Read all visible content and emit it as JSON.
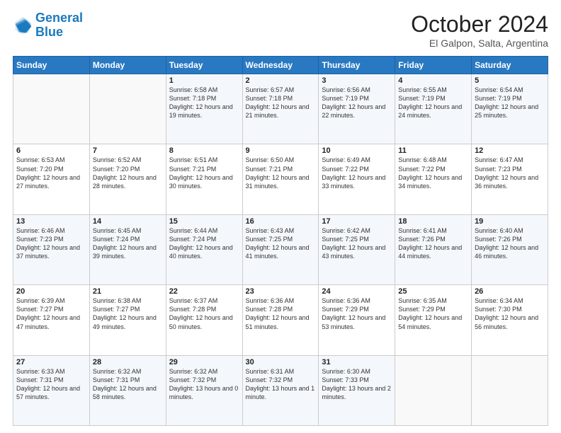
{
  "logo": {
    "line1": "General",
    "line2": "Blue"
  },
  "title": "October 2024",
  "subtitle": "El Galpon, Salta, Argentina",
  "weekdays": [
    "Sunday",
    "Monday",
    "Tuesday",
    "Wednesday",
    "Thursday",
    "Friday",
    "Saturday"
  ],
  "weeks": [
    [
      {
        "day": "",
        "info": ""
      },
      {
        "day": "",
        "info": ""
      },
      {
        "day": "1",
        "info": "Sunrise: 6:58 AM\nSunset: 7:18 PM\nDaylight: 12 hours and 19 minutes."
      },
      {
        "day": "2",
        "info": "Sunrise: 6:57 AM\nSunset: 7:18 PM\nDaylight: 12 hours and 21 minutes."
      },
      {
        "day": "3",
        "info": "Sunrise: 6:56 AM\nSunset: 7:19 PM\nDaylight: 12 hours and 22 minutes."
      },
      {
        "day": "4",
        "info": "Sunrise: 6:55 AM\nSunset: 7:19 PM\nDaylight: 12 hours and 24 minutes."
      },
      {
        "day": "5",
        "info": "Sunrise: 6:54 AM\nSunset: 7:19 PM\nDaylight: 12 hours and 25 minutes."
      }
    ],
    [
      {
        "day": "6",
        "info": "Sunrise: 6:53 AM\nSunset: 7:20 PM\nDaylight: 12 hours and 27 minutes."
      },
      {
        "day": "7",
        "info": "Sunrise: 6:52 AM\nSunset: 7:20 PM\nDaylight: 12 hours and 28 minutes."
      },
      {
        "day": "8",
        "info": "Sunrise: 6:51 AM\nSunset: 7:21 PM\nDaylight: 12 hours and 30 minutes."
      },
      {
        "day": "9",
        "info": "Sunrise: 6:50 AM\nSunset: 7:21 PM\nDaylight: 12 hours and 31 minutes."
      },
      {
        "day": "10",
        "info": "Sunrise: 6:49 AM\nSunset: 7:22 PM\nDaylight: 12 hours and 33 minutes."
      },
      {
        "day": "11",
        "info": "Sunrise: 6:48 AM\nSunset: 7:22 PM\nDaylight: 12 hours and 34 minutes."
      },
      {
        "day": "12",
        "info": "Sunrise: 6:47 AM\nSunset: 7:23 PM\nDaylight: 12 hours and 36 minutes."
      }
    ],
    [
      {
        "day": "13",
        "info": "Sunrise: 6:46 AM\nSunset: 7:23 PM\nDaylight: 12 hours and 37 minutes."
      },
      {
        "day": "14",
        "info": "Sunrise: 6:45 AM\nSunset: 7:24 PM\nDaylight: 12 hours and 39 minutes."
      },
      {
        "day": "15",
        "info": "Sunrise: 6:44 AM\nSunset: 7:24 PM\nDaylight: 12 hours and 40 minutes."
      },
      {
        "day": "16",
        "info": "Sunrise: 6:43 AM\nSunset: 7:25 PM\nDaylight: 12 hours and 41 minutes."
      },
      {
        "day": "17",
        "info": "Sunrise: 6:42 AM\nSunset: 7:25 PM\nDaylight: 12 hours and 43 minutes."
      },
      {
        "day": "18",
        "info": "Sunrise: 6:41 AM\nSunset: 7:26 PM\nDaylight: 12 hours and 44 minutes."
      },
      {
        "day": "19",
        "info": "Sunrise: 6:40 AM\nSunset: 7:26 PM\nDaylight: 12 hours and 46 minutes."
      }
    ],
    [
      {
        "day": "20",
        "info": "Sunrise: 6:39 AM\nSunset: 7:27 PM\nDaylight: 12 hours and 47 minutes."
      },
      {
        "day": "21",
        "info": "Sunrise: 6:38 AM\nSunset: 7:27 PM\nDaylight: 12 hours and 49 minutes."
      },
      {
        "day": "22",
        "info": "Sunrise: 6:37 AM\nSunset: 7:28 PM\nDaylight: 12 hours and 50 minutes."
      },
      {
        "day": "23",
        "info": "Sunrise: 6:36 AM\nSunset: 7:28 PM\nDaylight: 12 hours and 51 minutes."
      },
      {
        "day": "24",
        "info": "Sunrise: 6:36 AM\nSunset: 7:29 PM\nDaylight: 12 hours and 53 minutes."
      },
      {
        "day": "25",
        "info": "Sunrise: 6:35 AM\nSunset: 7:29 PM\nDaylight: 12 hours and 54 minutes."
      },
      {
        "day": "26",
        "info": "Sunrise: 6:34 AM\nSunset: 7:30 PM\nDaylight: 12 hours and 56 minutes."
      }
    ],
    [
      {
        "day": "27",
        "info": "Sunrise: 6:33 AM\nSunset: 7:31 PM\nDaylight: 12 hours and 57 minutes."
      },
      {
        "day": "28",
        "info": "Sunrise: 6:32 AM\nSunset: 7:31 PM\nDaylight: 12 hours and 58 minutes."
      },
      {
        "day": "29",
        "info": "Sunrise: 6:32 AM\nSunset: 7:32 PM\nDaylight: 13 hours and 0 minutes."
      },
      {
        "day": "30",
        "info": "Sunrise: 6:31 AM\nSunset: 7:32 PM\nDaylight: 13 hours and 1 minute."
      },
      {
        "day": "31",
        "info": "Sunrise: 6:30 AM\nSunset: 7:33 PM\nDaylight: 13 hours and 2 minutes."
      },
      {
        "day": "",
        "info": ""
      },
      {
        "day": "",
        "info": ""
      }
    ]
  ]
}
